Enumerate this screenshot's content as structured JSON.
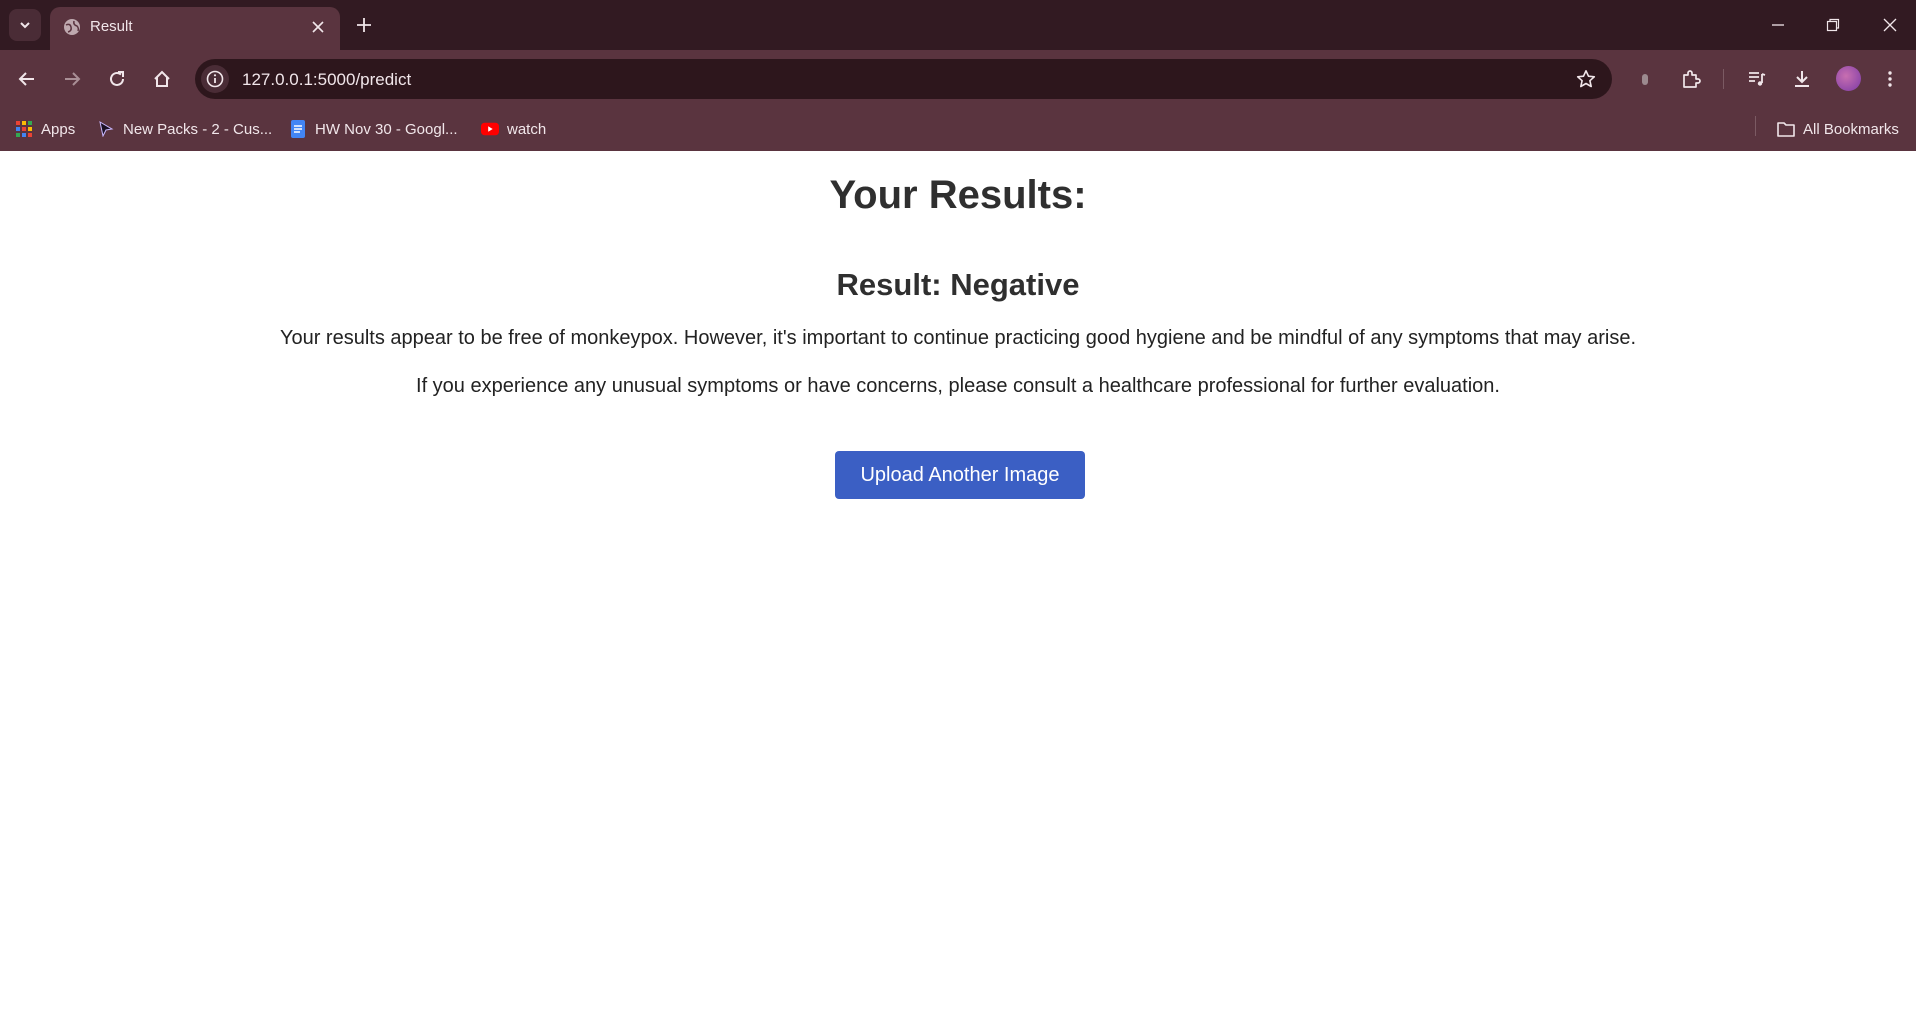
{
  "browser": {
    "tab": {
      "title": "Result"
    },
    "address_bar": {
      "url": "127.0.0.1:5000/predict"
    },
    "bookmarks": [
      {
        "label": "Apps",
        "icon": "apps-grid-icon"
      },
      {
        "label": "New Packs - 2 - Cus...",
        "icon": "cursor-icon"
      },
      {
        "label": "HW Nov 30 - Googl...",
        "icon": "google-docs-icon"
      },
      {
        "label": "watch",
        "icon": "youtube-icon"
      }
    ],
    "all_bookmarks": {
      "label": "All Bookmarks",
      "icon": "folder-icon"
    }
  },
  "page": {
    "heading": "Your Results:",
    "result": "Result: Negative",
    "paragraph_1": "Your results appear to be free of monkeypox. However, it's important to continue practicing good hygiene and be mindful of any symptoms that may arise.",
    "paragraph_2": "If you experience any unusual symptoms or have concerns, please consult a healthcare professional for further evaluation.",
    "button_label": "Upload Another Image"
  },
  "colors": {
    "tab_strip": "#321a22",
    "toolbar": "#5a343f",
    "button": "#3b5fc4",
    "text": "#2f2f2f"
  }
}
